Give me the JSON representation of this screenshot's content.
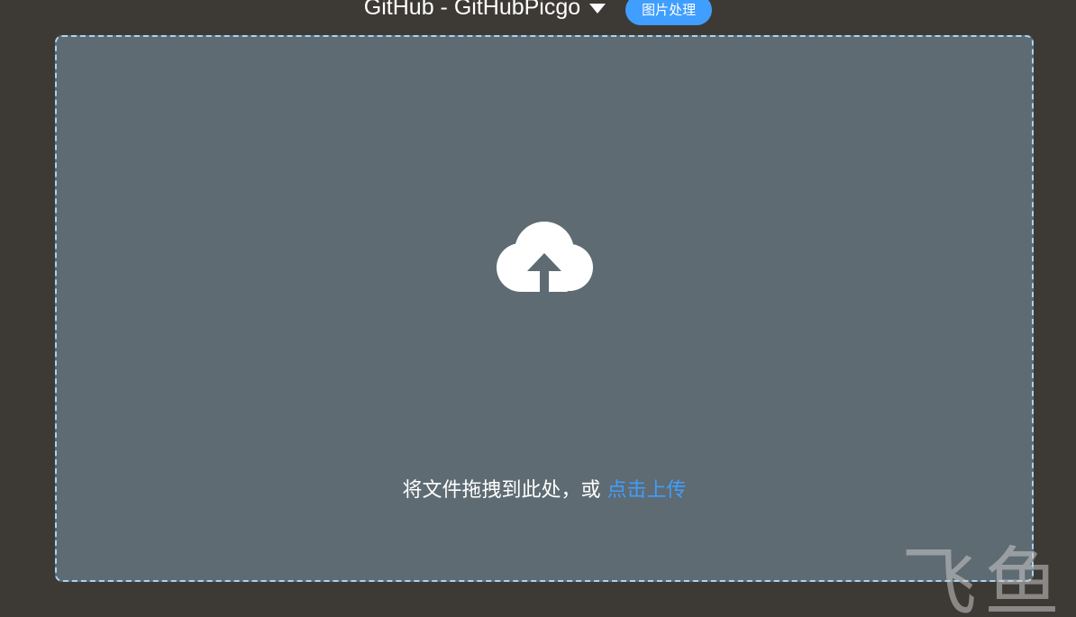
{
  "header": {
    "picbed_name": "GitHub - GitHubPicgo",
    "process_button_label": "图片处理"
  },
  "dropzone": {
    "hint_text": "将文件拖拽到此处，或 ",
    "upload_link_text": "点击上传",
    "icon": "cloud-upload-icon"
  },
  "watermark": {
    "text": "飞鱼"
  },
  "colors": {
    "background": "#3d3a36",
    "dropzone_fill": "#5e6b72",
    "dropzone_border": "#a9d3f7",
    "accent": "#409eff",
    "text": "#ffffff"
  }
}
